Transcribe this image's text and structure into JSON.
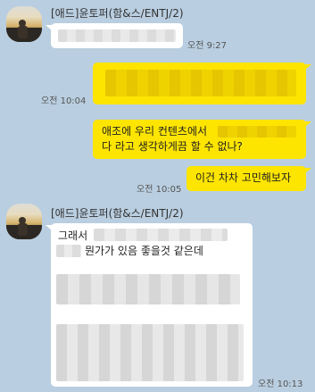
{
  "messages": [
    {
      "sender": "[애드]윤토퍼(함&스/ENTJ/2)",
      "time": "오전 9:27"
    },
    {
      "time": "오전 10:04"
    },
    {
      "line1": "애조에 우리 컨텐츠에서",
      "line2": "다 라고 생각하게끔 할 수 없나?"
    },
    {
      "text": "이건 차차 고민해보자",
      "time": "오전 10:05"
    },
    {
      "sender": "[애드]윤토퍼(함&스/ENTJ/2)",
      "line1": "그래서",
      "line2": "뭔가가 있음 좋을것 같은데",
      "time": "오전 10:13"
    }
  ],
  "colors": {
    "background": "#b9cee0",
    "bubble_mine": "#fee500",
    "bubble_theirs": "#ffffff",
    "redaction_yellow": "#e8c800",
    "redaction_gray": "#d8d8d8"
  },
  "icons": {
    "avatar": "profile-photo-sunset-person"
  }
}
